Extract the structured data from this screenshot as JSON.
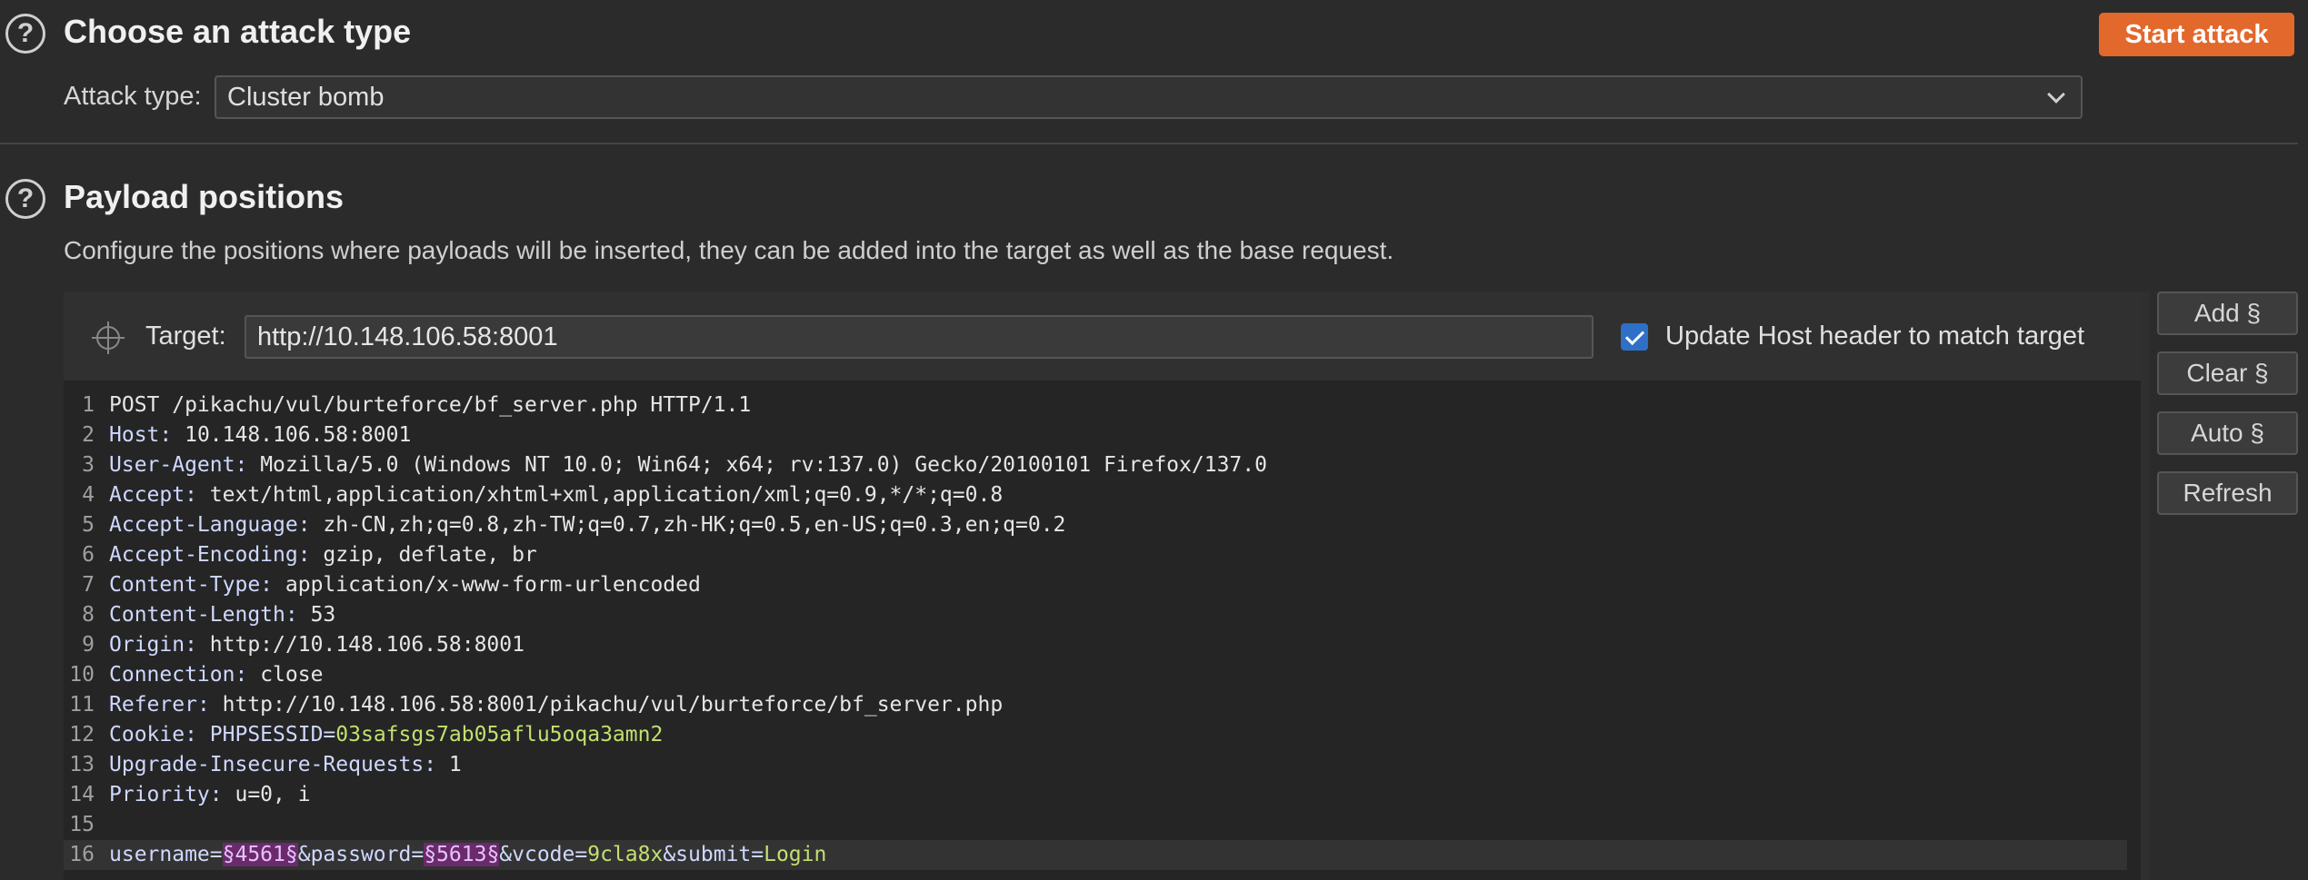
{
  "attack_section": {
    "help_icon": "question-circle-icon",
    "title": "Choose an attack type",
    "start_button": "Start attack",
    "attack_type_label": "Attack type:",
    "attack_type_value": "Cluster bomb"
  },
  "payload_section": {
    "help_icon": "question-circle-icon",
    "title": "Payload positions",
    "description": "Configure the positions where payloads will be inserted, they can be added into the target as well as the base request.",
    "target_label": "Target:",
    "target_value": "http://10.148.106.58:8001",
    "update_host_label": "Update Host header to match target",
    "update_host_checked": true
  },
  "side_buttons": {
    "add": "Add §",
    "clear": "Clear §",
    "auto": "Auto §",
    "refresh": "Refresh"
  },
  "request_lines": [
    {
      "n": "1",
      "key": "",
      "val": "POST /pikachu/vul/burteforce/bf_server.php HTTP/1.1"
    },
    {
      "n": "2",
      "key": "Host",
      "val": "10.148.106.58:8001"
    },
    {
      "n": "3",
      "key": "User-Agent",
      "val": "Mozilla/5.0 (Windows NT 10.0; Win64; x64; rv:137.0) Gecko/20100101 Firefox/137.0"
    },
    {
      "n": "4",
      "key": "Accept",
      "val": "text/html,application/xhtml+xml,application/xml;q=0.9,*/*;q=0.8"
    },
    {
      "n": "5",
      "key": "Accept-Language",
      "val": "zh-CN,zh;q=0.8,zh-TW;q=0.7,zh-HK;q=0.5,en-US;q=0.3,en;q=0.2"
    },
    {
      "n": "6",
      "key": "Accept-Encoding",
      "val": "gzip, deflate, br"
    },
    {
      "n": "7",
      "key": "Content-Type",
      "val": "application/x-www-form-urlencoded"
    },
    {
      "n": "8",
      "key": "Content-Length",
      "val": "53"
    },
    {
      "n": "9",
      "key": "Origin",
      "val": "http://10.148.106.58:8001"
    },
    {
      "n": "10",
      "key": "Connection",
      "val": "close"
    },
    {
      "n": "11",
      "key": "Referer",
      "val": "http://10.148.106.58:8001/pikachu/vul/burteforce/bf_server.php"
    },
    {
      "n": "12",
      "key": "Cookie",
      "val": "",
      "cookie_name": "PHPSESSID",
      "cookie_value": "03safsgs7ab05aflu5oqa3amn2"
    },
    {
      "n": "13",
      "key": "Upgrade-Insecure-Requests",
      "val": "1"
    },
    {
      "n": "14",
      "key": "Priority",
      "val": "u=0, i"
    },
    {
      "n": "15",
      "key": "",
      "val": ""
    }
  ],
  "body_line": {
    "n": "16",
    "p1_name": "username=",
    "p1_value": "§4561§",
    "p2_name": "&password=",
    "p2_value": "§5613§",
    "p3_name": "&vcode=",
    "p3_value": "9cla8x",
    "p4_name": "&submit=",
    "p4_value": "Login"
  },
  "colors": {
    "accent": "#e2682b",
    "checkbox": "#2e6fc7",
    "payload_highlight": "#6b2a6b",
    "value_green": "#c2e06f"
  }
}
